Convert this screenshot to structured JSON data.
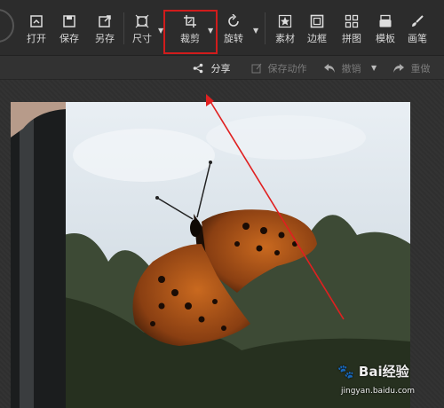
{
  "toolbar": {
    "tools": [
      {
        "id": "open",
        "label": "打开",
        "icon": "open-file-icon"
      },
      {
        "id": "save",
        "label": "保存",
        "icon": "save-icon"
      },
      {
        "id": "saveas",
        "label": "另存",
        "icon": "save-as-icon"
      },
      {
        "id": "size",
        "label": "尺寸",
        "icon": "resize-icon"
      },
      {
        "id": "crop",
        "label": "裁剪",
        "icon": "crop-icon"
      },
      {
        "id": "rotate",
        "label": "旋转",
        "icon": "rotate-icon"
      },
      {
        "id": "material",
        "label": "素材",
        "icon": "star-icon"
      },
      {
        "id": "border",
        "label": "边框",
        "icon": "frame-icon"
      },
      {
        "id": "collage",
        "label": "拼图",
        "icon": "grid-icon"
      },
      {
        "id": "template",
        "label": "模板",
        "icon": "template-icon"
      },
      {
        "id": "brush",
        "label": "画笔",
        "icon": "brush-icon"
      }
    ]
  },
  "subbar": {
    "share": "分享",
    "save_action": "保存动作",
    "undo": "撤销",
    "redo": "重做"
  },
  "watermark": {
    "brand": "Bai经验",
    "url": "jingyan.baidu.com"
  },
  "colors": {
    "highlight": "#d11c1c",
    "arrow": "#e02020"
  }
}
